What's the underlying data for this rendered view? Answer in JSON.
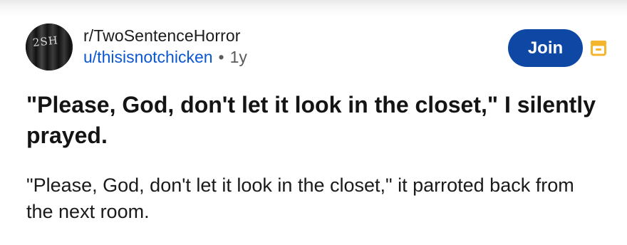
{
  "post": {
    "subreddit": "r/TwoSentenceHorror",
    "author": "u/thisisnotchicken",
    "separator": "•",
    "age": "1y",
    "join_label": "Join",
    "title": "\"Please, God, don't let it look in the closet,\" I silently prayed.",
    "body": "\"Please, God, don't let it look in the closet,\" it parroted back from the next room.",
    "avatar_text": "2SH"
  },
  "icons": {
    "avatar": "subreddit-avatar",
    "archive": "archive-box-icon"
  },
  "colors": {
    "join_button": "#0f47a5",
    "author_link": "#0b57d0",
    "archive_icon": "#f4b42c"
  }
}
